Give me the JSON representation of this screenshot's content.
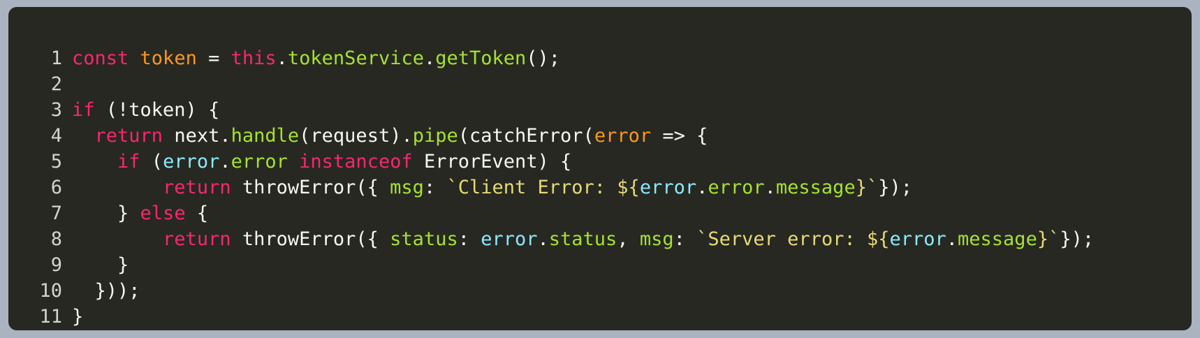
{
  "editor": {
    "lines": [
      {
        "number": "1",
        "tokens": [
          {
            "text": "const",
            "cls": "kw"
          },
          {
            "text": " ",
            "cls": "plain"
          },
          {
            "text": "token",
            "cls": "var"
          },
          {
            "text": " = ",
            "cls": "plain"
          },
          {
            "text": "this",
            "cls": "kw"
          },
          {
            "text": ".",
            "cls": "plain"
          },
          {
            "text": "tokenService",
            "cls": "fn"
          },
          {
            "text": ".",
            "cls": "plain"
          },
          {
            "text": "getToken",
            "cls": "fn"
          },
          {
            "text": "();",
            "cls": "plain"
          }
        ]
      },
      {
        "number": "2",
        "tokens": []
      },
      {
        "number": "3",
        "tokens": [
          {
            "text": "if",
            "cls": "kw"
          },
          {
            "text": " (!token) {",
            "cls": "plain"
          }
        ]
      },
      {
        "number": "4",
        "tokens": [
          {
            "text": "  ",
            "cls": "plain"
          },
          {
            "text": "return",
            "cls": "kw"
          },
          {
            "text": " next.",
            "cls": "plain"
          },
          {
            "text": "handle",
            "cls": "fn"
          },
          {
            "text": "(request).",
            "cls": "plain"
          },
          {
            "text": "pipe",
            "cls": "fn"
          },
          {
            "text": "(catchError(",
            "cls": "plain"
          },
          {
            "text": "error",
            "cls": "param"
          },
          {
            "text": " => {",
            "cls": "plain"
          }
        ]
      },
      {
        "number": "5",
        "tokens": [
          {
            "text": "    ",
            "cls": "plain"
          },
          {
            "text": "if",
            "cls": "kw"
          },
          {
            "text": " (",
            "cls": "plain"
          },
          {
            "text": "error",
            "cls": "obj"
          },
          {
            "text": ".",
            "cls": "plain"
          },
          {
            "text": "error",
            "cls": "prop"
          },
          {
            "text": " ",
            "cls": "plain"
          },
          {
            "text": "instanceof",
            "cls": "kw"
          },
          {
            "text": " ErrorEvent) {",
            "cls": "plain"
          }
        ]
      },
      {
        "number": "6",
        "tokens": [
          {
            "text": "        ",
            "cls": "plain"
          },
          {
            "text": "return",
            "cls": "kw"
          },
          {
            "text": " throwError({ ",
            "cls": "plain"
          },
          {
            "text": "msg",
            "cls": "prop"
          },
          {
            "text": ": ",
            "cls": "plain"
          },
          {
            "text": "`Client Error: ${",
            "cls": "str"
          },
          {
            "text": "error",
            "cls": "obj"
          },
          {
            "text": ".",
            "cls": "plain"
          },
          {
            "text": "error",
            "cls": "prop"
          },
          {
            "text": ".",
            "cls": "plain"
          },
          {
            "text": "message",
            "cls": "prop"
          },
          {
            "text": "}`",
            "cls": "str"
          },
          {
            "text": "});",
            "cls": "plain"
          }
        ]
      },
      {
        "number": "7",
        "tokens": [
          {
            "text": "    } ",
            "cls": "plain"
          },
          {
            "text": "else",
            "cls": "kw"
          },
          {
            "text": " {",
            "cls": "plain"
          }
        ]
      },
      {
        "number": "8",
        "tokens": [
          {
            "text": "        ",
            "cls": "plain"
          },
          {
            "text": "return",
            "cls": "kw"
          },
          {
            "text": " throwError({ ",
            "cls": "plain"
          },
          {
            "text": "status",
            "cls": "prop"
          },
          {
            "text": ": ",
            "cls": "plain"
          },
          {
            "text": "error",
            "cls": "obj"
          },
          {
            "text": ".",
            "cls": "plain"
          },
          {
            "text": "status",
            "cls": "prop"
          },
          {
            "text": ", ",
            "cls": "plain"
          },
          {
            "text": "msg",
            "cls": "prop"
          },
          {
            "text": ": ",
            "cls": "plain"
          },
          {
            "text": "`Server error: ${",
            "cls": "str"
          },
          {
            "text": "error",
            "cls": "obj"
          },
          {
            "text": ".",
            "cls": "plain"
          },
          {
            "text": "message",
            "cls": "prop"
          },
          {
            "text": "}`",
            "cls": "str"
          },
          {
            "text": "});",
            "cls": "plain"
          }
        ]
      },
      {
        "number": "9",
        "tokens": [
          {
            "text": "    }",
            "cls": "plain"
          }
        ]
      },
      {
        "number": "10",
        "tokens": [
          {
            "text": "  }));",
            "cls": "plain"
          }
        ]
      },
      {
        "number": "11",
        "tokens": [
          {
            "text": "}",
            "cls": "plain"
          }
        ]
      }
    ]
  }
}
